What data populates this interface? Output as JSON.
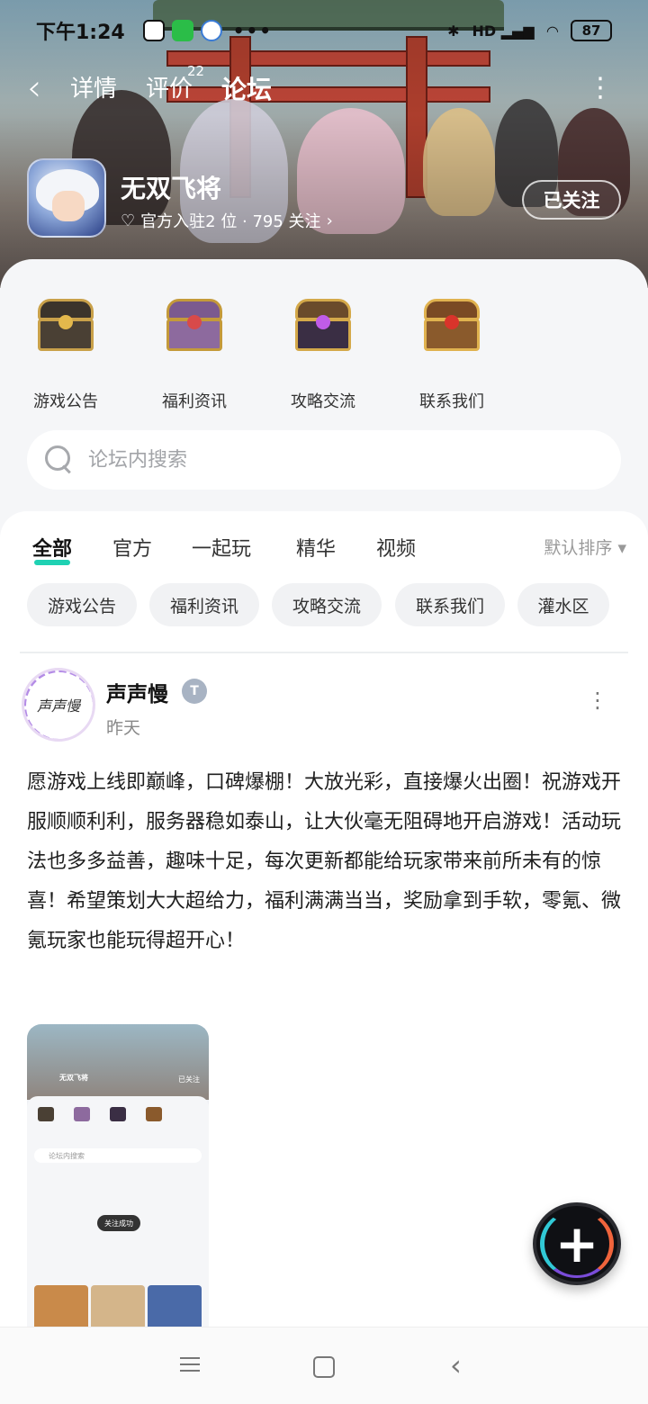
{
  "status_bar": {
    "time": "下午1:24",
    "battery": "87",
    "network_label": "HD"
  },
  "top_nav": {
    "tabs": [
      {
        "label": "详情"
      },
      {
        "label": "评价"
      },
      {
        "label": "论坛"
      }
    ],
    "review_badge": "22",
    "active_tab": "论坛"
  },
  "game": {
    "name": "无双飞将",
    "meta": "官方入驻2 位 · 795 关注",
    "follow_label": "已关注"
  },
  "shortcuts": [
    {
      "label": "游戏公告"
    },
    {
      "label": "福利资讯"
    },
    {
      "label": "攻略交流"
    },
    {
      "label": "联系我们"
    }
  ],
  "search": {
    "placeholder": "论坛内搜索"
  },
  "filters": {
    "tabs": [
      "全部",
      "官方",
      "一起玩",
      "精华",
      "视频"
    ],
    "sort_label": "默认排序 ▾"
  },
  "chips": [
    "游戏公告",
    "福利资讯",
    "攻略交流",
    "联系我们",
    "灌水区"
  ],
  "post": {
    "author": "声声慢",
    "avatar_text": "声声慢",
    "time": "昨天",
    "content": "愿游戏上线即巅峰，口碑爆棚！大放光彩，直接爆火出圈！祝游戏开服顺顺利利，服务器稳如泰山，让大伙毫无阻碍地开启游戏！活动玩法也多多益善，趣味十足，每次更新都能给玩家带来前所未有的惊喜！希望策划大大超给力，福利满满当当，奖励拿到手软，零氪、微氪玩家也能玩得超开心！"
  },
  "thumbnail": {
    "game_name": "无双飞将",
    "follow_label": "已关注",
    "search_label": "论坛内搜索",
    "toast": "关注成功"
  },
  "fab": {
    "label": "+"
  },
  "colors": {
    "accent": "#1fd1b3",
    "background": "#f5f6f8"
  }
}
